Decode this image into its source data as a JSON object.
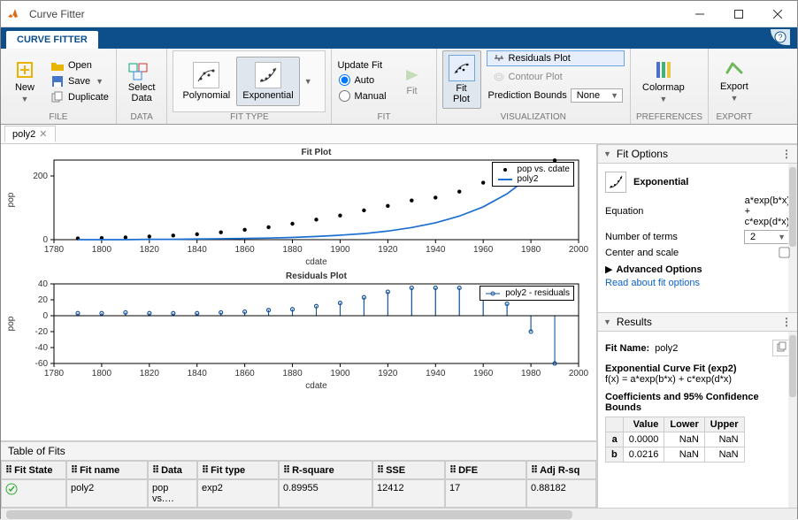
{
  "window": {
    "title": "Curve Fitter"
  },
  "tabs": {
    "main": "CURVE FITTER"
  },
  "ribbon": {
    "file": {
      "new": "New",
      "open": "Open",
      "save": "Save",
      "duplicate": "Duplicate",
      "group": "FILE"
    },
    "data": {
      "select": "Select\nData",
      "group": "DATA"
    },
    "fittype": {
      "poly": "Polynomial",
      "exp": "Exponential",
      "group": "FIT TYPE"
    },
    "fit": {
      "update": "Update Fit",
      "auto": "Auto",
      "manual": "Manual",
      "fit": "Fit",
      "group": "FIT"
    },
    "viz": {
      "fitplot": "Fit\nPlot",
      "residuals": "Residuals Plot",
      "contour": "Contour Plot",
      "pbounds": "Prediction Bounds",
      "pbounds_val": "None",
      "group": "VISUALIZATION"
    },
    "prefs": {
      "colormap": "Colormap",
      "group": "PREFERENCES"
    },
    "export": {
      "export": "Export",
      "group": "EXPORT"
    }
  },
  "doctab": {
    "name": "poly2"
  },
  "fitoptions": {
    "title": "Fit Options",
    "type": "Exponential",
    "eq_label": "Equation",
    "eq1": "a*exp(b*x)",
    "eqplus": "+",
    "eq2": "c*exp(d*x)",
    "nterms_label": "Number of terms",
    "nterms": "2",
    "cs_label": "Center and scale",
    "adv": "Advanced Options",
    "read": "Read about fit options"
  },
  "results": {
    "title": "Results",
    "fitname_label": "Fit Name:",
    "fitname": "poly2",
    "head": "Exponential Curve Fit (exp2)",
    "formula": "f(x) = a*exp(b*x) + c*exp(d*x)",
    "coef_head": "Coefficients and 95% Confidence Bounds",
    "cols": {
      "v": "Value",
      "l": "Lower",
      "u": "Upper"
    },
    "rows": [
      {
        "n": "a",
        "v": "0.0000",
        "l": "NaN",
        "u": "NaN"
      },
      {
        "n": "b",
        "v": "0.0216",
        "l": "NaN",
        "u": "NaN"
      }
    ]
  },
  "tof": {
    "title": "Table of Fits",
    "headers": [
      "Fit State",
      "Fit name",
      "Data",
      "Fit type",
      "R-square",
      "SSE",
      "DFE",
      "Adj R-sq"
    ],
    "row": {
      "name": "poly2",
      "data": "pop vs.…",
      "type": "exp2",
      "r2": "0.89955",
      "sse": "12412",
      "dfe": "17",
      "ar2": "0.88182"
    }
  },
  "chart_data": [
    {
      "type": "scatter+line",
      "title": "Fit Plot",
      "xlabel": "cdate",
      "ylabel": "pop",
      "xlim": [
        1780,
        2000
      ],
      "ylim": [
        0,
        250
      ],
      "xticks": [
        1780,
        1800,
        1820,
        1840,
        1860,
        1880,
        1900,
        1920,
        1940,
        1960,
        1980,
        2000
      ],
      "yticks": [
        0,
        200
      ],
      "legend": [
        "pop vs. cdate",
        "poly2"
      ],
      "series": [
        {
          "name": "pop vs. cdate",
          "style": "dots",
          "x": [
            1790,
            1800,
            1810,
            1820,
            1830,
            1840,
            1850,
            1860,
            1870,
            1880,
            1890,
            1900,
            1910,
            1920,
            1930,
            1940,
            1950,
            1960,
            1970,
            1980,
            1990
          ],
          "y": [
            4,
            5,
            7,
            10,
            13,
            17,
            23,
            31,
            39,
            50,
            63,
            76,
            92,
            106,
            123,
            132,
            151,
            179,
            203,
            227,
            249
          ]
        },
        {
          "name": "poly2",
          "style": "line",
          "x": [
            1790,
            1800,
            1810,
            1820,
            1830,
            1840,
            1850,
            1860,
            1870,
            1880,
            1890,
            1900,
            1910,
            1920,
            1930,
            1940,
            1950,
            1960,
            1970,
            1980
          ],
          "y": [
            0,
            0,
            0,
            1,
            1,
            2,
            3,
            4,
            5,
            7,
            10,
            14,
            19,
            27,
            38,
            53,
            74,
            103,
            144,
            201
          ]
        }
      ]
    },
    {
      "type": "stem",
      "title": "Residuals Plot",
      "xlabel": "cdate",
      "ylabel": "pop",
      "xlim": [
        1780,
        2000
      ],
      "ylim": [
        -60,
        40
      ],
      "xticks": [
        1780,
        1800,
        1820,
        1840,
        1860,
        1880,
        1900,
        1920,
        1940,
        1960,
        1980,
        2000
      ],
      "yticks": [
        -60,
        -40,
        -20,
        0,
        20,
        40
      ],
      "legend": [
        "poly2 - residuals"
      ],
      "series": [
        {
          "name": "poly2 - residuals",
          "x": [
            1790,
            1800,
            1810,
            1820,
            1830,
            1840,
            1850,
            1860,
            1870,
            1880,
            1890,
            1900,
            1910,
            1920,
            1930,
            1940,
            1950,
            1960,
            1970,
            1980,
            1990
          ],
          "y": [
            3,
            3,
            4,
            3,
            3,
            3,
            4,
            5,
            7,
            8,
            12,
            16,
            23,
            30,
            35,
            35,
            35,
            30,
            15,
            -20,
            -60
          ]
        }
      ]
    }
  ]
}
